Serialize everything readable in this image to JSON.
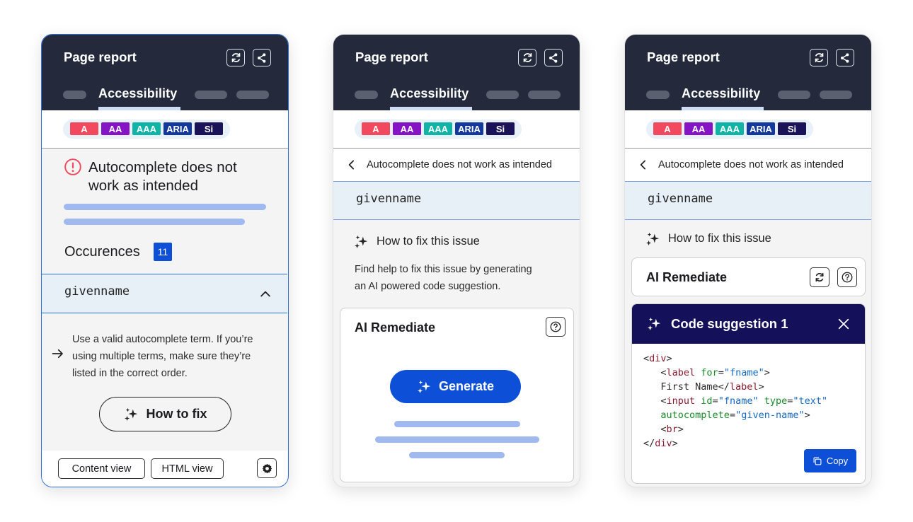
{
  "header": {
    "title": "Page report",
    "active_tab": "Accessibility",
    "refresh_icon": "refresh-icon",
    "share_icon": "share-icon"
  },
  "levels": [
    "A",
    "AA",
    "AAA",
    "ARIA",
    "Si"
  ],
  "panel1": {
    "issue_title_line1": "Autocomplete does not",
    "issue_title_line2": "work as intended",
    "occurrences_label": "Occurences",
    "occurrences_count": "11",
    "element_name": "givenname",
    "guidance_line1": "Use a valid autocomplete term. If you’re",
    "guidance_line2": "using multiple terms, make sure they’re",
    "guidance_line3": "listed in the correct order.",
    "how_to_fix_label": "How to fix",
    "content_view_label": "Content view",
    "html_view_label": "HTML view"
  },
  "panel2": {
    "back_label": "Autocomplete does not work as intended",
    "element_name": "givenname",
    "how_to_fix_heading": "How to fix this issue",
    "description_line1": "Find help to fix this issue by generating",
    "description_line2": "an AI powered code suggestion.",
    "ai_card_title": "AI Remediate",
    "generate_label": "Generate"
  },
  "panel3": {
    "back_label": "Autocomplete does not work as intended",
    "element_name": "givenname",
    "how_to_fix_heading": "How to fix this issue",
    "ai_card_title": "AI Remediate",
    "suggestion_title": "Code suggestion 1",
    "copy_label": "Copy",
    "code_lines": [
      [
        {
          "t": "<",
          "c": "p"
        },
        {
          "t": "div",
          "c": "tag"
        },
        {
          "t": ">",
          "c": "p"
        }
      ],
      [
        {
          "t": "   <",
          "c": "p"
        },
        {
          "t": "label",
          "c": "tag"
        },
        {
          "t": " ",
          "c": "p"
        },
        {
          "t": "for",
          "c": "attr"
        },
        {
          "t": "=",
          "c": "p"
        },
        {
          "t": "\"fname\"",
          "c": "val"
        },
        {
          "t": ">",
          "c": "p"
        }
      ],
      [
        {
          "t": "   First Name</",
          "c": "p"
        },
        {
          "t": "label",
          "c": "tag"
        },
        {
          "t": ">",
          "c": "p"
        }
      ],
      [
        {
          "t": "   <",
          "c": "p"
        },
        {
          "t": "input",
          "c": "tag"
        },
        {
          "t": " ",
          "c": "p"
        },
        {
          "t": "id",
          "c": "attr"
        },
        {
          "t": "=",
          "c": "p"
        },
        {
          "t": "\"fname\"",
          "c": "val"
        },
        {
          "t": " ",
          "c": "p"
        },
        {
          "t": "type",
          "c": "attr"
        },
        {
          "t": "=",
          "c": "p"
        },
        {
          "t": "\"text\"",
          "c": "val"
        }
      ],
      [
        {
          "t": "   ",
          "c": "p"
        },
        {
          "t": "autocomplete",
          "c": "attr"
        },
        {
          "t": "=",
          "c": "p"
        },
        {
          "t": "\"given-name\"",
          "c": "val"
        },
        {
          "t": ">",
          "c": "p"
        }
      ],
      [
        {
          "t": "   <",
          "c": "p"
        },
        {
          "t": "br",
          "c": "tag"
        },
        {
          "t": ">",
          "c": "p"
        }
      ],
      [
        {
          "t": "</",
          "c": "p"
        },
        {
          "t": "div",
          "c": "tag"
        },
        {
          "t": ">",
          "c": "p"
        }
      ]
    ]
  },
  "colors": {
    "header_bg": "#242a3c",
    "primary_blue": "#0d4fd6",
    "suggestion_header": "#14115a",
    "skeleton": "#a0b9ee",
    "error": "#f2495f"
  }
}
